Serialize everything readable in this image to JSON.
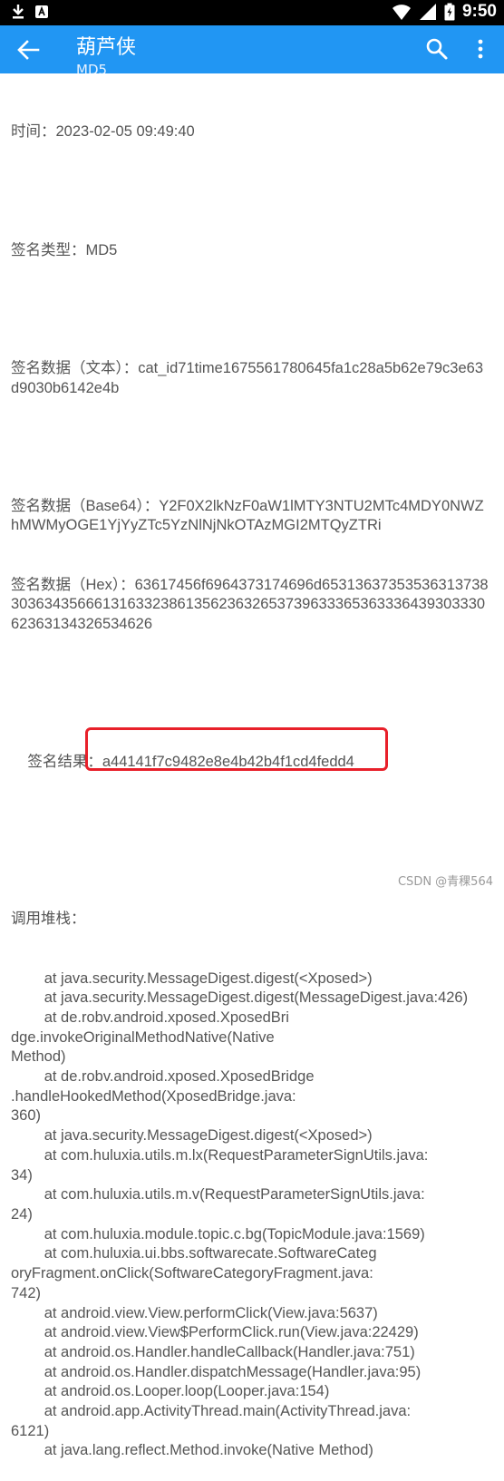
{
  "status_bar": {
    "time": "9:50"
  },
  "app_bar": {
    "title": "葫芦侠",
    "subtitle": "MD5"
  },
  "content": {
    "time_line": "时间：2023-02-05 09:49:40",
    "sign_type_line": "签名类型：MD5",
    "text_data_line": "签名数据（文本）：cat_id71time1675561780645fa1c28a5b62e79c3e63d9030b6142e4b",
    "base64_line": "签名数据（Base64）：Y2F0X2lkNzF0aW1lMTY3NTU2MTc4MDY0NWZhMWMyOGE1YjYyZTc5YzNlNjNkOTAzMGI2MTQyZTRi",
    "hex_line": "签名数据（Hex）：63617456f6964373174696d6531363735353631373830363435666131633238613562363265373963336536333643930333062363134326534626",
    "result_label": "签名结果：",
    "result_value": "a44141f7c9482e8e4b42b4f1cd4fedd4",
    "stack_title": "调用堆栈：",
    "stack_lines": [
      "        at java.security.MessageDigest.digest(<Xposed>)",
      "        at java.security.MessageDigest.digest(MessageDigest.java:426)",
      "        at de.robv.android.xposed.XposedBri\ndge.invokeOriginalMethodNative(Native\nMethod)",
      "        at de.robv.android.xposed.XposedBridge\n.handleHookedMethod(XposedBridge.java:\n360)",
      "        at java.security.MessageDigest.digest(<Xposed>)",
      "        at com.huluxia.utils.m.lx(RequestParameterSignUtils.java:\n34)",
      "        at com.huluxia.utils.m.v(RequestParameterSignUtils.java:\n24)",
      "        at com.huluxia.module.topic.c.bg(TopicModule.java:1569)",
      "        at com.huluxia.ui.bbs.softwarecate.SoftwareCateg\noryFragment.onClick(SoftwareCategoryFragment.java:\n742)",
      "        at android.view.View.performClick(View.java:5637)",
      "        at android.view.View$PerformClick.run(View.java:22429)",
      "        at android.os.Handler.handleCallback(Handler.java:751)",
      "        at android.os.Handler.dispatchMessage(Handler.java:95)",
      "        at android.os.Looper.loop(Looper.java:154)",
      "        at android.app.ActivityThread.main(ActivityThread.java:\n6121)",
      "        at java.lang.reflect.Method.invoke(Native Method)"
    ]
  },
  "watermark": "CSDN @青稞564",
  "colors": {
    "app_bar": "#2196f3",
    "highlight": "#e8202a",
    "text": "#555555"
  }
}
